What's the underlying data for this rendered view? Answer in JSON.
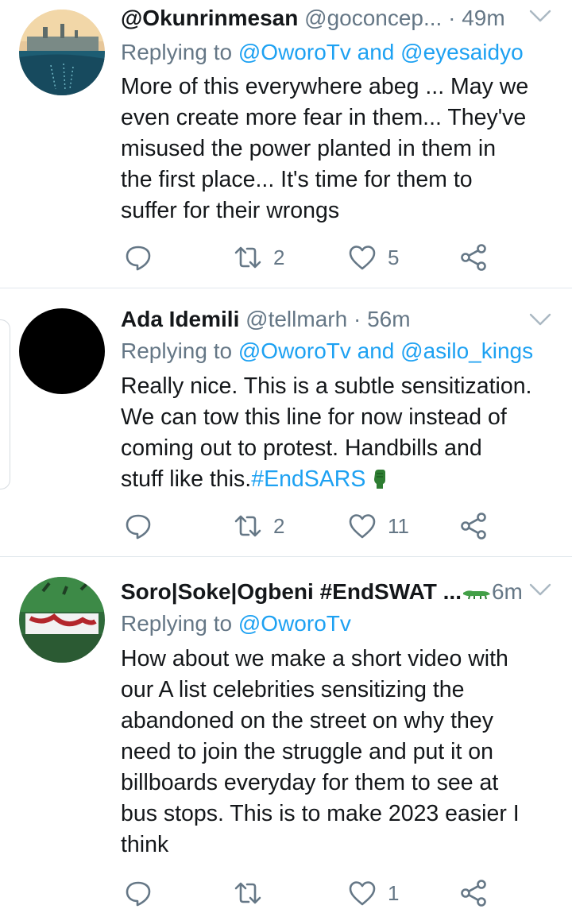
{
  "tweets": [
    {
      "name": "@Okunrinmesan",
      "handle": "@goconcep...",
      "separator": "·",
      "time": "49m",
      "replying_prefix": "Replying to",
      "replying_targets": "@OworoTv and @eyesaidyo",
      "body": "More of this everywhere abeg ... May we\neven create more fear in them... They've\nmisused the power planted in them in\nthe first place... It's time for them to\nsuffer for their wrongs",
      "retweets": "2",
      "likes": "5"
    },
    {
      "name": "Ada Idemili",
      "handle": "@tellmarh",
      "separator": "·",
      "time": "56m",
      "replying_prefix": "Replying to",
      "replying_targets": "@OworoTv and @asilo_kings",
      "body": "Really nice. This is a subtle sensitization.\nWe can tow this line for now instead of\ncoming out to protest. Handbills and\nstuff like this.",
      "hashtag": "#EndSARS",
      "retweets": "2",
      "likes": "11"
    },
    {
      "name": "Soro|Soke|Ogbeni #EndSWAT ...",
      "time": "6m",
      "replying_prefix": "Replying to",
      "replying_targets": "@OworoTv",
      "body": "How about we make a short video with\nour A list celebrities sensitizing the\nabandoned on the street on why they\nneed to join the struggle and put it on\nbillboards everyday for them to see at\nbus stops. This is to make 2023 easier I\nthink",
      "likes": "1"
    }
  ],
  "icons": {
    "reply": "reply-icon",
    "retweet": "retweet-icon",
    "like": "heart-icon",
    "share": "share-icon",
    "caret": "chevron-down-icon"
  },
  "colors": {
    "link": "#1da1f2",
    "muted": "#657786",
    "text": "#14171a",
    "divider": "#e1e8ed"
  }
}
